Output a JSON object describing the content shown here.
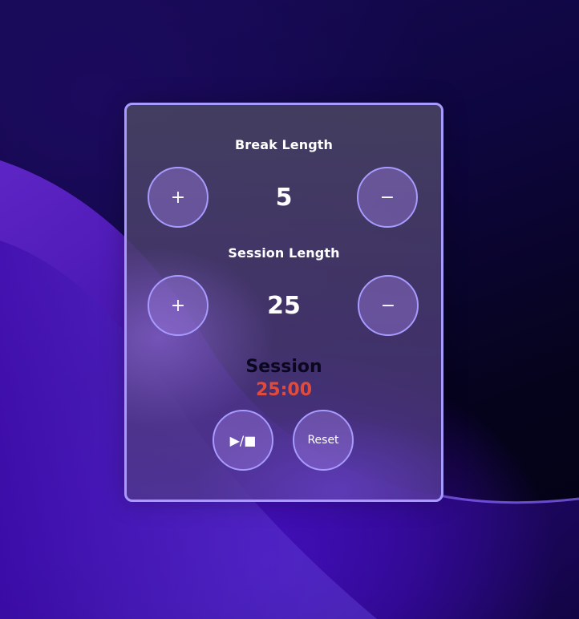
{
  "break": {
    "label": "Break Length",
    "value": "5",
    "increment_label": "+",
    "decrement_label": "−"
  },
  "session": {
    "label": "Session Length",
    "value": "25",
    "increment_label": "+",
    "decrement_label": "−"
  },
  "timer": {
    "mode_label": "Session",
    "time": "25:00",
    "time_color": "#e04b3c"
  },
  "controls": {
    "start_stop_label": "▶/■",
    "reset_label": "Reset"
  },
  "colors": {
    "accent_border": "#a89bff",
    "background_dark": "#05031c",
    "background_purple": "#4a10c8"
  }
}
